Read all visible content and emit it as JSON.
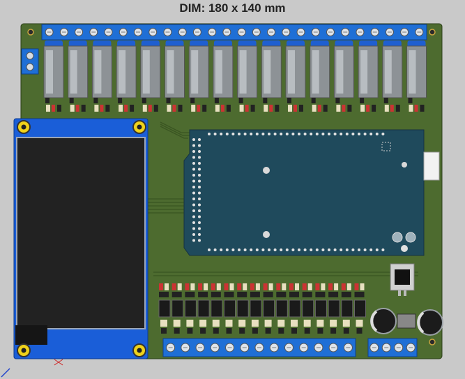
{
  "header": {
    "title": "DIM: 180 x 140 mm"
  },
  "colors": {
    "background": "#c9c9c9",
    "pcb": "#4d6b2f",
    "pcb_dark": "#3e5a25",
    "terminal_blue": "#1f6fd6",
    "relay_body": "#8d9296",
    "relay_cap": "#1f5fd0",
    "display_blue": "#1a5ed8",
    "display_screen": "#222222",
    "module_teal": "#1f4a5c",
    "ic_black": "#1a1a1a",
    "capacitor": "#1b1b1b"
  },
  "board": {
    "top_terminal_count": 26,
    "relay_count": 16,
    "bottom_terminal_count": 13,
    "power_terminal_count": 4,
    "left_terminal_count": 2,
    "driver_ic_count": 16,
    "capacitor_count": 2,
    "regulator_count": 1,
    "mount_hole_count": 4
  },
  "icons": {
    "mount": "mount-hole-icon",
    "axis": "axis-indicator-icon"
  }
}
